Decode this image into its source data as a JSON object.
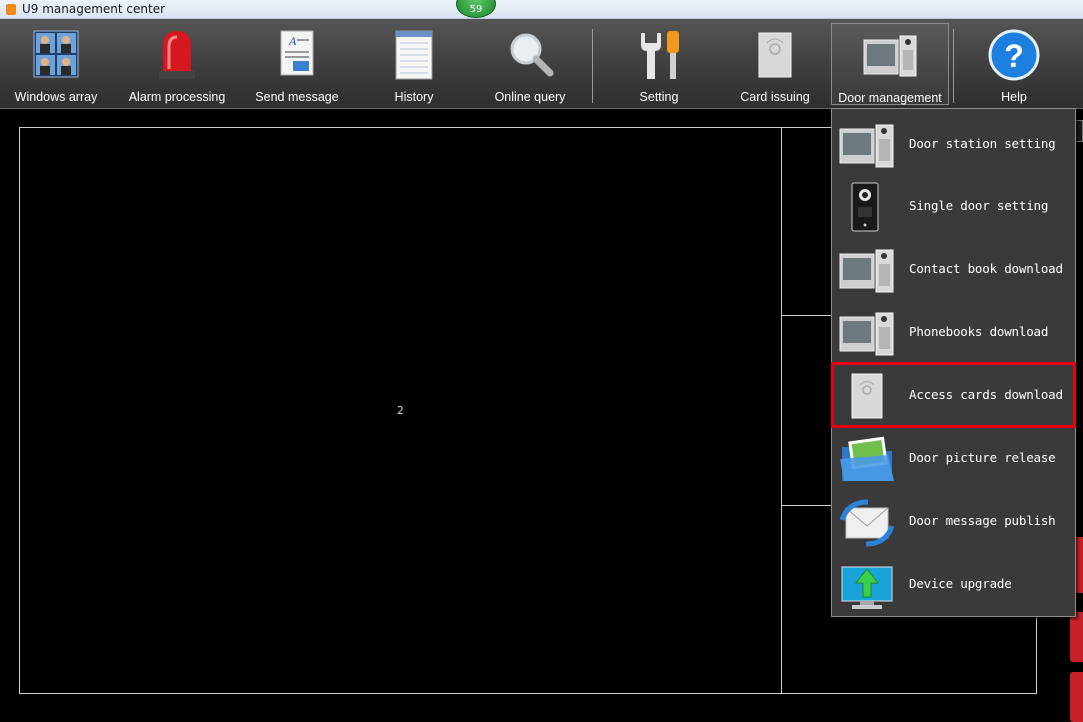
{
  "window": {
    "title": "U9 management center",
    "badge": "59"
  },
  "toolbar": {
    "items": [
      {
        "label": "Windows array",
        "icon": "windows-array-icon"
      },
      {
        "label": "Alarm processing",
        "icon": "alarm-light-icon"
      },
      {
        "label": "Send message",
        "icon": "document-icon"
      },
      {
        "label": "History",
        "icon": "notepad-icon"
      },
      {
        "label": "Online query",
        "icon": "magnifier-icon"
      },
      {
        "label": "Setting",
        "icon": "wrench-screwdriver-icon"
      },
      {
        "label": "Card issuing",
        "icon": "card-reader-icon"
      },
      {
        "label": "Door management",
        "icon": "door-station-icon"
      },
      {
        "label": "Help",
        "icon": "help-icon"
      }
    ]
  },
  "video": {
    "main_window_number": "2"
  },
  "door_menu": {
    "items": [
      {
        "label": "Door station setting",
        "icon": "door-station-icon"
      },
      {
        "label": "Single door setting",
        "icon": "single-door-icon"
      },
      {
        "label": "Contact book download",
        "icon": "door-station-icon"
      },
      {
        "label": "Phonebooks download",
        "icon": "door-station-icon"
      },
      {
        "label": "Access cards download",
        "icon": "card-reader-icon",
        "highlighted": true
      },
      {
        "label": "Door picture release",
        "icon": "picture-folder-icon"
      },
      {
        "label": "Door message publish",
        "icon": "mail-sync-icon"
      },
      {
        "label": "Device upgrade",
        "icon": "upgrade-monitor-icon"
      }
    ]
  },
  "colors": {
    "highlight": "#e60012",
    "toolbar_bg": "#3c3c3c",
    "menu_bg": "#3a3a3a"
  }
}
